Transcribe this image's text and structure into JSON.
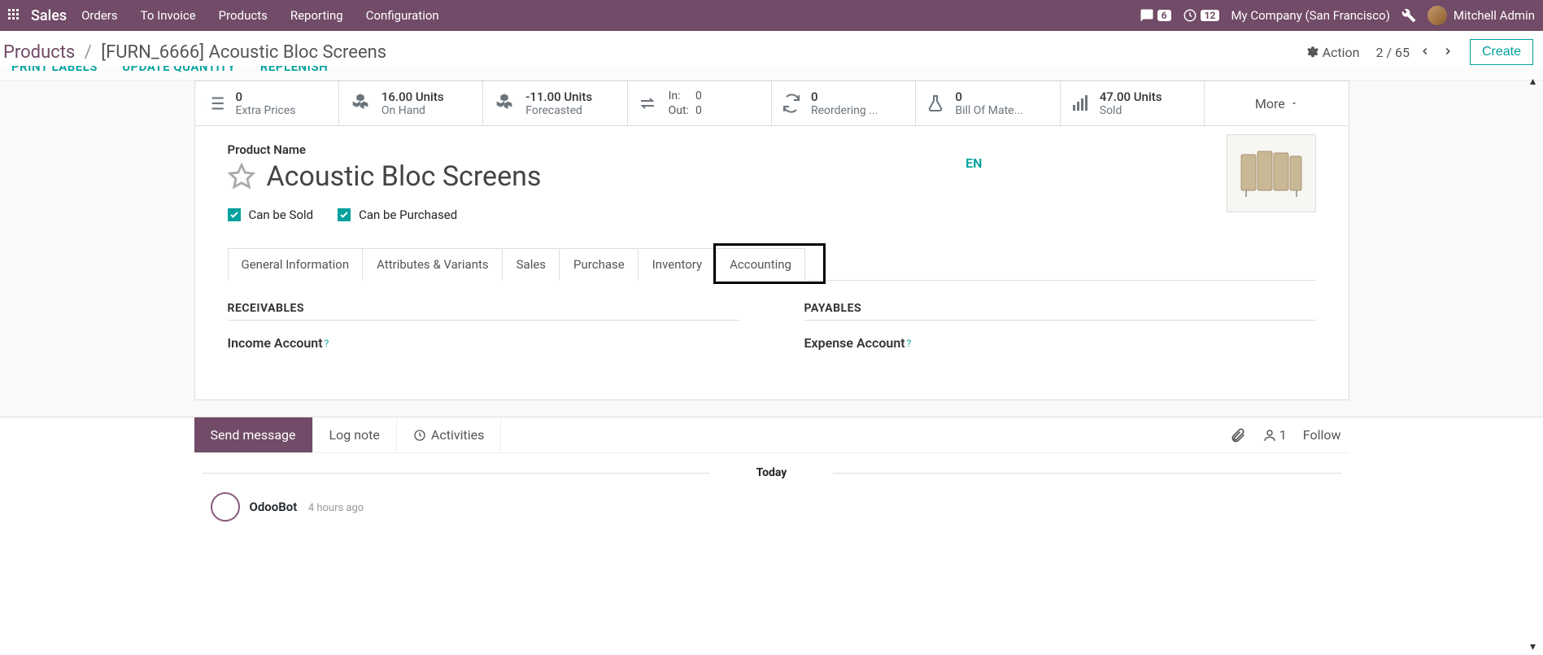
{
  "topbar": {
    "brand": "Sales",
    "menu": [
      "Orders",
      "To Invoice",
      "Products",
      "Reporting",
      "Configuration"
    ],
    "messages_badge": "6",
    "activities_badge": "12",
    "company": "My Company (San Francisco)",
    "user": "Mitchell Admin"
  },
  "breadcrumb": {
    "root": "Products",
    "current": "[FURN_6666] Acoustic Bloc Screens"
  },
  "controlbar": {
    "action_label": "Action",
    "pager": "2 / 65",
    "create_label": "Create"
  },
  "action_buttons": [
    "PRINT LABELS",
    "UPDATE QUANTITY",
    "REPLENISH"
  ],
  "stats": {
    "extra_prices": {
      "value": "0",
      "label": "Extra Prices"
    },
    "on_hand": {
      "value": "16.00 Units",
      "label": "On Hand"
    },
    "forecasted": {
      "value": "-11.00 Units",
      "label": "Forecasted"
    },
    "inout": {
      "in_label": "In:",
      "in_val": "0",
      "out_label": "Out:",
      "out_val": "0"
    },
    "reordering": {
      "value": "0",
      "label": "Reordering ..."
    },
    "bom": {
      "value": "0",
      "label": "Bill Of Mate..."
    },
    "sold": {
      "value": "47.00 Units",
      "label": "Sold"
    },
    "more": "More"
  },
  "product": {
    "name_label": "Product Name",
    "name": "Acoustic Bloc Screens",
    "lang": "EN",
    "can_be_sold": "Can be Sold",
    "can_be_purchased": "Can be Purchased"
  },
  "tabs": [
    "General Information",
    "Attributes & Variants",
    "Sales",
    "Purchase",
    "Inventory",
    "Accounting"
  ],
  "active_tab_index": 5,
  "accounting": {
    "receivables_title": "RECEIVABLES",
    "income_account": "Income Account",
    "payables_title": "PAYABLES",
    "expense_account": "Expense Account"
  },
  "chatter": {
    "send": "Send message",
    "log": "Log note",
    "activities": "Activities",
    "followers": "1",
    "follow": "Follow",
    "today": "Today",
    "msg_author": "OdooBot",
    "msg_time": "4 hours ago"
  }
}
